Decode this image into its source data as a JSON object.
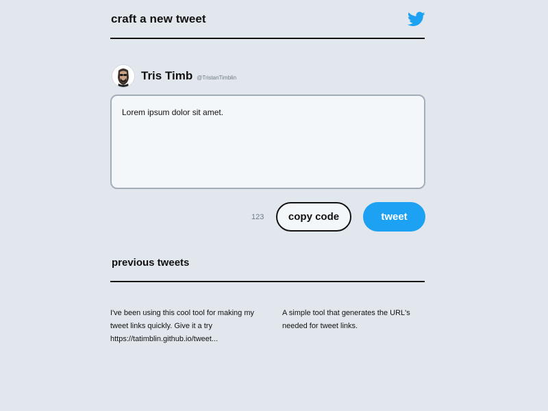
{
  "header": {
    "title": "craft a new tweet",
    "logo_icon": "twitter-bird-icon"
  },
  "profile": {
    "name": "Tris Timb",
    "handle": "@TristanTimblin"
  },
  "composer": {
    "text": "Lorem ipsum dolor sit amet.",
    "char_count": "123",
    "copy_label": "copy code",
    "tweet_label": "tweet"
  },
  "previous": {
    "title": "previous tweets",
    "items": [
      {
        "text": "I've been using this cool tool for making my tweet links quickly. Give it a try https://tatimblin.github.io/tweet..."
      },
      {
        "text": "A simple tool that generates the URL's needed for tweet links."
      }
    ]
  },
  "colors": {
    "background": "#e1e7ed",
    "accent": "#1da1f2",
    "box_border": "#a3adb8",
    "box_fill": "#f4f7fa",
    "text": "#111111",
    "muted": "#6f7a85"
  }
}
